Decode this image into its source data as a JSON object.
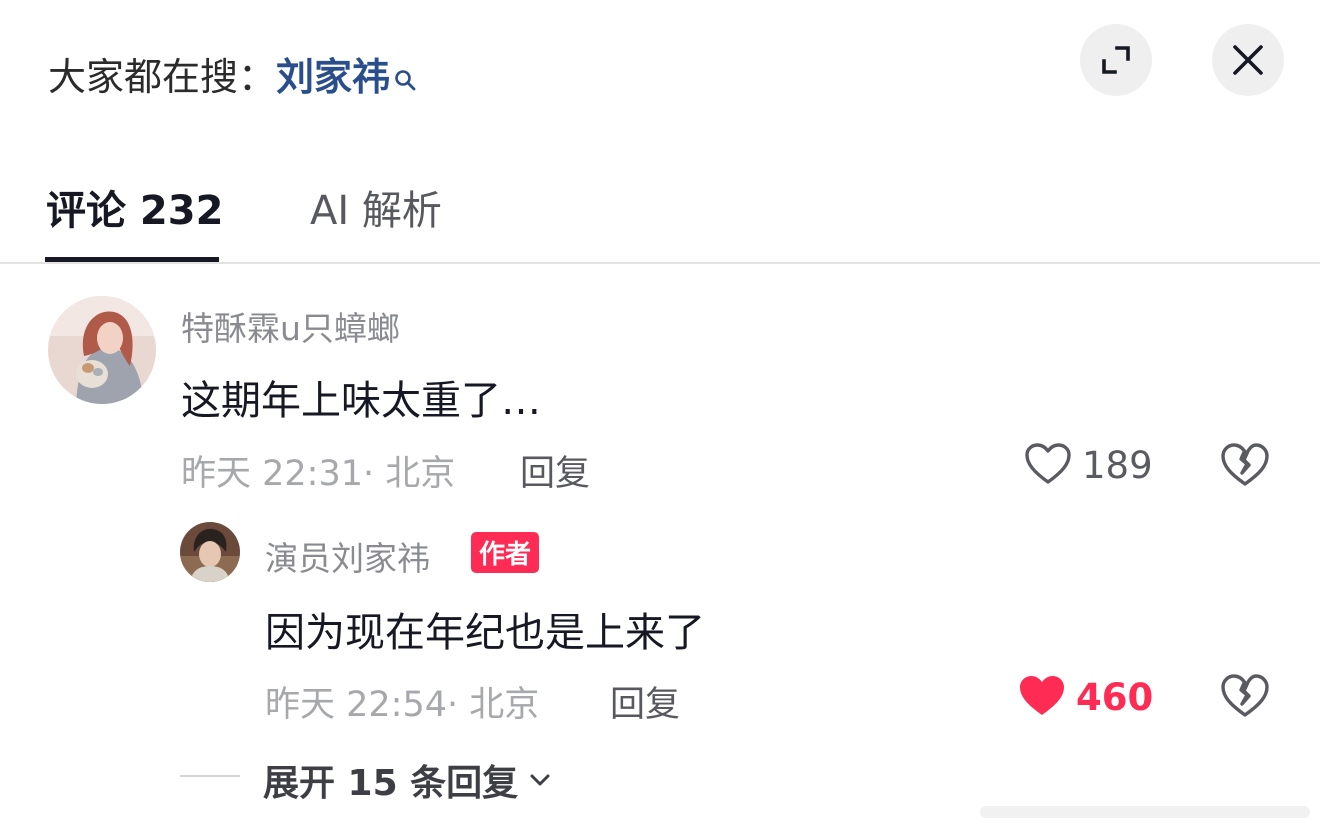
{
  "header": {
    "prefix": "大家都在搜：",
    "keyword": "刘家祎"
  },
  "tabs": [
    {
      "label": "评论 232",
      "active": true
    },
    {
      "label": "AI 解析",
      "active": false
    }
  ],
  "comment": {
    "username": "特酥霖u只蟑螂",
    "text": "这期年上味太重了…",
    "time_location": "昨天 22:31· 北京",
    "reply_label": "回复",
    "likes": "189"
  },
  "reply": {
    "username": "演员刘家祎",
    "badge": "作者",
    "text": "因为现在年纪也是上来了",
    "time_location": "昨天 22:54· 北京",
    "reply_label": "回复",
    "likes": "460"
  },
  "expand": {
    "label": "展开 15 条回复"
  },
  "colors": {
    "accent_red": "#fe2c55",
    "keyword_blue": "#2a4e8c"
  }
}
